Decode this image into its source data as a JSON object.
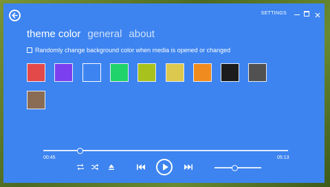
{
  "app": {
    "title": "SETTINGS",
    "accent": "#3d84f0"
  },
  "nav": {
    "tabs": [
      {
        "label": "theme color",
        "active": true
      },
      {
        "label": "general",
        "active": false
      },
      {
        "label": "about",
        "active": false
      }
    ]
  },
  "options": {
    "random_color_label": "Randomly change background color when media is opened or changed",
    "random_color_checked": false
  },
  "swatches": [
    {
      "name": "red",
      "color": "#e34949"
    },
    {
      "name": "purple",
      "color": "#7b3ff0"
    },
    {
      "name": "blue",
      "color": "#3d84f0",
      "selected": true
    },
    {
      "name": "green",
      "color": "#20d36a"
    },
    {
      "name": "lime",
      "color": "#a9c11c"
    },
    {
      "name": "yellow",
      "color": "#dcc84f"
    },
    {
      "name": "orange",
      "color": "#f08b1f"
    },
    {
      "name": "black",
      "color": "#1c1c1c"
    },
    {
      "name": "gray",
      "color": "#515151"
    },
    {
      "name": "brown",
      "color": "#8a6c55"
    }
  ],
  "player": {
    "elapsed": "00:45",
    "duration": "05:13",
    "progress_fraction": 0.15,
    "volume_fraction": 0.42
  },
  "icons": {
    "back": "back-arrow-icon",
    "repeat": "repeat-icon",
    "shuffle": "shuffle-icon",
    "eject": "eject-icon",
    "previous": "skip-previous-icon",
    "play": "play-icon",
    "next": "skip-next-icon",
    "minimize": "minimize-icon",
    "maximize": "maximize-icon",
    "close": "close-icon"
  }
}
